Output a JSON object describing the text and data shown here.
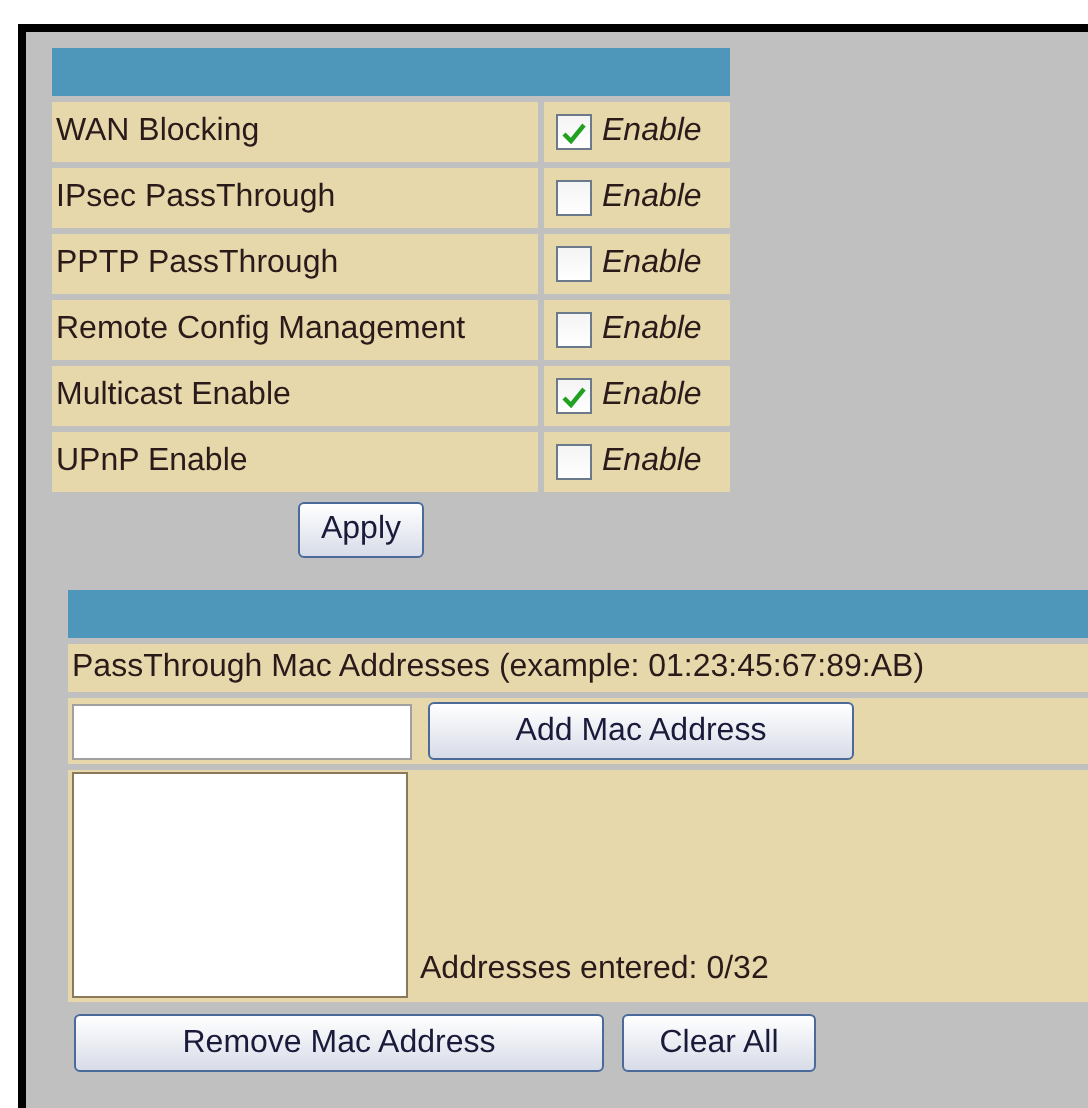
{
  "options": [
    {
      "label": "WAN Blocking",
      "checked": true,
      "option_label": "Enable"
    },
    {
      "label": "IPsec PassThrough",
      "checked": false,
      "option_label": "Enable"
    },
    {
      "label": "PPTP PassThrough",
      "checked": false,
      "option_label": "Enable"
    },
    {
      "label": "Remote Config Management",
      "checked": false,
      "option_label": "Enable"
    },
    {
      "label": "Multicast Enable",
      "checked": true,
      "option_label": "Enable"
    },
    {
      "label": "UPnP Enable",
      "checked": false,
      "option_label": "Enable"
    }
  ],
  "apply_button": "Apply",
  "mac_section": {
    "heading": "PassThrough Mac Addresses (example: 01:23:45:67:89:AB)",
    "add_button": "Add Mac Address",
    "count_text": "Addresses entered: 0/32",
    "remove_button": "Remove Mac Address",
    "clear_button": "Clear All"
  }
}
